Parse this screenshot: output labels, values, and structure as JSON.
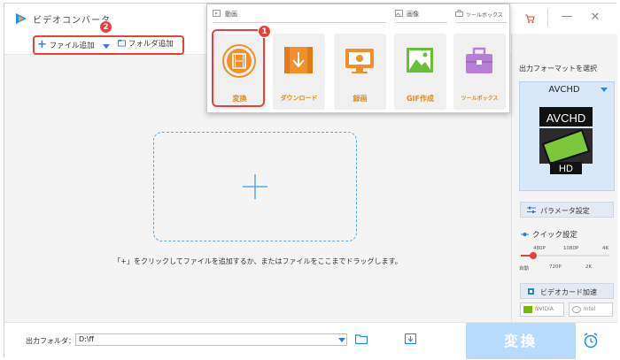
{
  "window": {
    "title": "ビデオコンバータ"
  },
  "toolbar": {
    "add_file_label": "ファイル追加",
    "add_folder_label": "フォルダ追加"
  },
  "main": {
    "hint": "「+」をクリックしてファイルを追加するか、またはファイルをここまでドラッグします。"
  },
  "popup": {
    "categories": [
      {
        "label": "動画"
      },
      {
        "label": "画像"
      },
      {
        "label": "ツールボックス"
      }
    ],
    "tiles": [
      {
        "label": "変換",
        "icon": "film-convert-icon"
      },
      {
        "label": "ダウンロード",
        "icon": "download-icon"
      },
      {
        "label": "録画",
        "icon": "monitor-record-icon"
      },
      {
        "label": "GIF作成",
        "icon": "image-landscape-icon"
      },
      {
        "label": "ツールボックス",
        "icon": "toolbox-icon"
      }
    ]
  },
  "right_panel": {
    "output_format_title": "出力フォーマットを選択",
    "format_name": "AVCHD",
    "format_logo_top": "AVCHD",
    "format_logo_bottom": "HD",
    "param_button": "パラメータ設定",
    "quick_setting": "クイック設定",
    "ticks_top": [
      "480P",
      "1080P",
      "4K"
    ],
    "ticks_bottom": [
      "自動",
      "720P",
      "2K"
    ],
    "gpu_button": "ビデオカード加速",
    "gpu_vendors": [
      "NVIDIA",
      "Intel"
    ]
  },
  "bottom": {
    "output_folder_label": "出力フォルダ：",
    "output_folder_value": "D:\\ff",
    "convert_label": "変換"
  },
  "badges": {
    "one": "1",
    "two": "2"
  },
  "colors": {
    "accent_red": "#e8413b",
    "accent_blue": "#1a8fe0",
    "convert_disabled": "#b7dcfb",
    "tile_orange": "#f0902a",
    "tile_green": "#6abf3a",
    "tile_purple": "#b77ed6"
  }
}
